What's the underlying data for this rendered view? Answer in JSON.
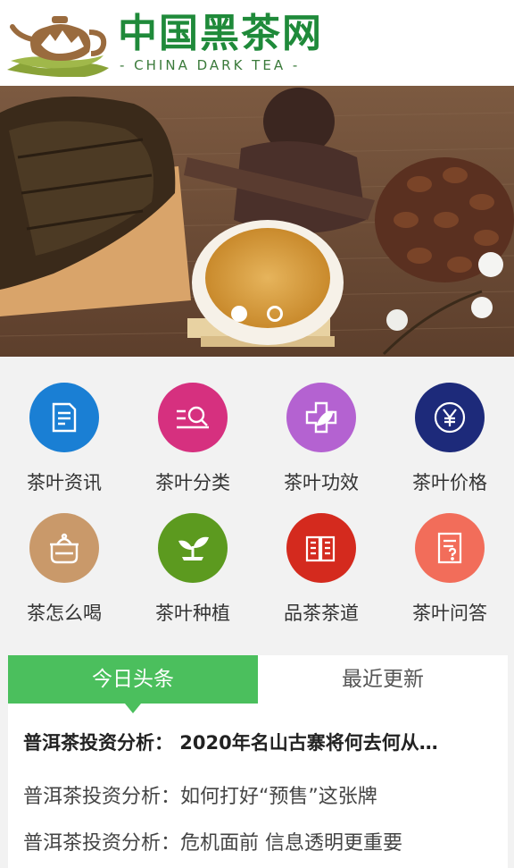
{
  "header": {
    "logo_cn": "中国黑茶网",
    "logo_en": "- CHINA DARK TEA -"
  },
  "banner": {
    "slide_count": 2,
    "active_slide": 1
  },
  "nav": {
    "items": [
      {
        "label": "茶叶资讯",
        "icon": "document-icon",
        "color": "#1a7fd4"
      },
      {
        "label": "茶叶分类",
        "icon": "search-list-icon",
        "color": "#d6307f"
      },
      {
        "label": "茶叶功效",
        "icon": "medical-leaf-icon",
        "color": "#b462d1"
      },
      {
        "label": "茶叶价格",
        "icon": "yen-icon",
        "color": "#1d2a7a"
      },
      {
        "label": "茶怎么喝",
        "icon": "pot-icon",
        "color": "#c9996a"
      },
      {
        "label": "茶叶种植",
        "icon": "sprout-icon",
        "color": "#5c9a1f"
      },
      {
        "label": "品茶茶道",
        "icon": "book-icon",
        "color": "#d42a1e"
      },
      {
        "label": "茶叶问答",
        "icon": "question-doc-icon",
        "color": "#f26d5a"
      }
    ]
  },
  "news": {
    "tab_active": "今日头条",
    "tab_inactive": "最近更新",
    "headline": "普洱茶投资分析： 2020年名山古寨将何去何从…",
    "items": [
      "普洱茶投资分析：如何打好“预售”这张牌",
      "普洱茶投资分析：危机面前 信息透明更重要"
    ]
  },
  "colors": {
    "brand_green": "#1f8a3a",
    "tab_green": "#4bbf5d"
  }
}
